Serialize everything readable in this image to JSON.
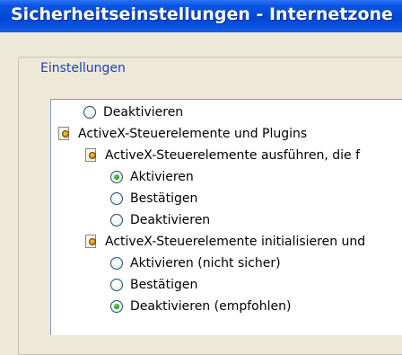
{
  "window": {
    "title": "Sicherheitseinstellungen - Internetzone"
  },
  "group": {
    "label": "Einstellungen"
  },
  "settings": {
    "items": [
      {
        "label": "Deaktivieren"
      },
      {
        "label": "ActiveX-Steuerelemente und Plugins"
      },
      {
        "label": "ActiveX-Steuerelemente ausführen, die f"
      },
      {
        "label": "Aktivieren"
      },
      {
        "label": "Bestätigen"
      },
      {
        "label": "Deaktivieren"
      },
      {
        "label": "ActiveX-Steuerelemente initialisieren und"
      },
      {
        "label": "Aktivieren (nicht sicher)"
      },
      {
        "label": "Bestätigen"
      },
      {
        "label": "Deaktivieren (empfohlen)"
      }
    ]
  },
  "icons": {
    "category": "settings-category-icon",
    "radio": "radio-button"
  }
}
